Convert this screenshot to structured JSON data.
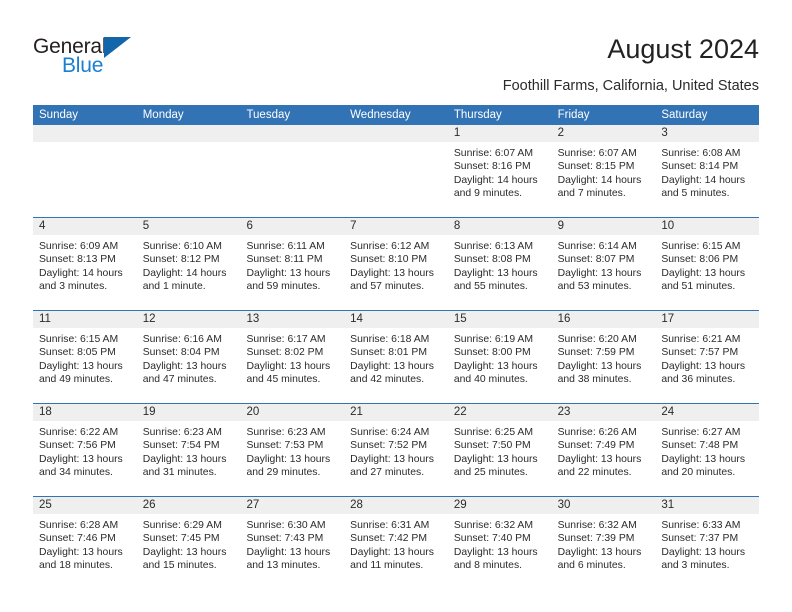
{
  "brand": {
    "name_top": "General",
    "name_bottom": "Blue",
    "triangle_color": "#1466ab",
    "blue_text_color": "#1b7fd1"
  },
  "header": {
    "title": "August 2024",
    "location": "Foothill Farms, California, United States"
  },
  "colors": {
    "header_blue": "#3173b4",
    "date_band": "#efefef",
    "text": "#2b2b2b"
  },
  "weekdays": [
    "Sunday",
    "Monday",
    "Tuesday",
    "Wednesday",
    "Thursday",
    "Friday",
    "Saturday"
  ],
  "weeks": [
    [
      {
        "day": "",
        "lines": []
      },
      {
        "day": "",
        "lines": []
      },
      {
        "day": "",
        "lines": []
      },
      {
        "day": "",
        "lines": []
      },
      {
        "day": "1",
        "lines": [
          "Sunrise: 6:07 AM",
          "Sunset: 8:16 PM",
          "Daylight: 14 hours",
          "and 9 minutes."
        ]
      },
      {
        "day": "2",
        "lines": [
          "Sunrise: 6:07 AM",
          "Sunset: 8:15 PM",
          "Daylight: 14 hours",
          "and 7 minutes."
        ]
      },
      {
        "day": "3",
        "lines": [
          "Sunrise: 6:08 AM",
          "Sunset: 8:14 PM",
          "Daylight: 14 hours",
          "and 5 minutes."
        ]
      }
    ],
    [
      {
        "day": "4",
        "lines": [
          "Sunrise: 6:09 AM",
          "Sunset: 8:13 PM",
          "Daylight: 14 hours",
          "and 3 minutes."
        ]
      },
      {
        "day": "5",
        "lines": [
          "Sunrise: 6:10 AM",
          "Sunset: 8:12 PM",
          "Daylight: 14 hours",
          "and 1 minute."
        ]
      },
      {
        "day": "6",
        "lines": [
          "Sunrise: 6:11 AM",
          "Sunset: 8:11 PM",
          "Daylight: 13 hours",
          "and 59 minutes."
        ]
      },
      {
        "day": "7",
        "lines": [
          "Sunrise: 6:12 AM",
          "Sunset: 8:10 PM",
          "Daylight: 13 hours",
          "and 57 minutes."
        ]
      },
      {
        "day": "8",
        "lines": [
          "Sunrise: 6:13 AM",
          "Sunset: 8:08 PM",
          "Daylight: 13 hours",
          "and 55 minutes."
        ]
      },
      {
        "day": "9",
        "lines": [
          "Sunrise: 6:14 AM",
          "Sunset: 8:07 PM",
          "Daylight: 13 hours",
          "and 53 minutes."
        ]
      },
      {
        "day": "10",
        "lines": [
          "Sunrise: 6:15 AM",
          "Sunset: 8:06 PM",
          "Daylight: 13 hours",
          "and 51 minutes."
        ]
      }
    ],
    [
      {
        "day": "11",
        "lines": [
          "Sunrise: 6:15 AM",
          "Sunset: 8:05 PM",
          "Daylight: 13 hours",
          "and 49 minutes."
        ]
      },
      {
        "day": "12",
        "lines": [
          "Sunrise: 6:16 AM",
          "Sunset: 8:04 PM",
          "Daylight: 13 hours",
          "and 47 minutes."
        ]
      },
      {
        "day": "13",
        "lines": [
          "Sunrise: 6:17 AM",
          "Sunset: 8:02 PM",
          "Daylight: 13 hours",
          "and 45 minutes."
        ]
      },
      {
        "day": "14",
        "lines": [
          "Sunrise: 6:18 AM",
          "Sunset: 8:01 PM",
          "Daylight: 13 hours",
          "and 42 minutes."
        ]
      },
      {
        "day": "15",
        "lines": [
          "Sunrise: 6:19 AM",
          "Sunset: 8:00 PM",
          "Daylight: 13 hours",
          "and 40 minutes."
        ]
      },
      {
        "day": "16",
        "lines": [
          "Sunrise: 6:20 AM",
          "Sunset: 7:59 PM",
          "Daylight: 13 hours",
          "and 38 minutes."
        ]
      },
      {
        "day": "17",
        "lines": [
          "Sunrise: 6:21 AM",
          "Sunset: 7:57 PM",
          "Daylight: 13 hours",
          "and 36 minutes."
        ]
      }
    ],
    [
      {
        "day": "18",
        "lines": [
          "Sunrise: 6:22 AM",
          "Sunset: 7:56 PM",
          "Daylight: 13 hours",
          "and 34 minutes."
        ]
      },
      {
        "day": "19",
        "lines": [
          "Sunrise: 6:23 AM",
          "Sunset: 7:54 PM",
          "Daylight: 13 hours",
          "and 31 minutes."
        ]
      },
      {
        "day": "20",
        "lines": [
          "Sunrise: 6:23 AM",
          "Sunset: 7:53 PM",
          "Daylight: 13 hours",
          "and 29 minutes."
        ]
      },
      {
        "day": "21",
        "lines": [
          "Sunrise: 6:24 AM",
          "Sunset: 7:52 PM",
          "Daylight: 13 hours",
          "and 27 minutes."
        ]
      },
      {
        "day": "22",
        "lines": [
          "Sunrise: 6:25 AM",
          "Sunset: 7:50 PM",
          "Daylight: 13 hours",
          "and 25 minutes."
        ]
      },
      {
        "day": "23",
        "lines": [
          "Sunrise: 6:26 AM",
          "Sunset: 7:49 PM",
          "Daylight: 13 hours",
          "and 22 minutes."
        ]
      },
      {
        "day": "24",
        "lines": [
          "Sunrise: 6:27 AM",
          "Sunset: 7:48 PM",
          "Daylight: 13 hours",
          "and 20 minutes."
        ]
      }
    ],
    [
      {
        "day": "25",
        "lines": [
          "Sunrise: 6:28 AM",
          "Sunset: 7:46 PM",
          "Daylight: 13 hours",
          "and 18 minutes."
        ]
      },
      {
        "day": "26",
        "lines": [
          "Sunrise: 6:29 AM",
          "Sunset: 7:45 PM",
          "Daylight: 13 hours",
          "and 15 minutes."
        ]
      },
      {
        "day": "27",
        "lines": [
          "Sunrise: 6:30 AM",
          "Sunset: 7:43 PM",
          "Daylight: 13 hours",
          "and 13 minutes."
        ]
      },
      {
        "day": "28",
        "lines": [
          "Sunrise: 6:31 AM",
          "Sunset: 7:42 PM",
          "Daylight: 13 hours",
          "and 11 minutes."
        ]
      },
      {
        "day": "29",
        "lines": [
          "Sunrise: 6:32 AM",
          "Sunset: 7:40 PM",
          "Daylight: 13 hours",
          "and 8 minutes."
        ]
      },
      {
        "day": "30",
        "lines": [
          "Sunrise: 6:32 AM",
          "Sunset: 7:39 PM",
          "Daylight: 13 hours",
          "and 6 minutes."
        ]
      },
      {
        "day": "31",
        "lines": [
          "Sunrise: 6:33 AM",
          "Sunset: 7:37 PM",
          "Daylight: 13 hours",
          "and 3 minutes."
        ]
      }
    ]
  ]
}
